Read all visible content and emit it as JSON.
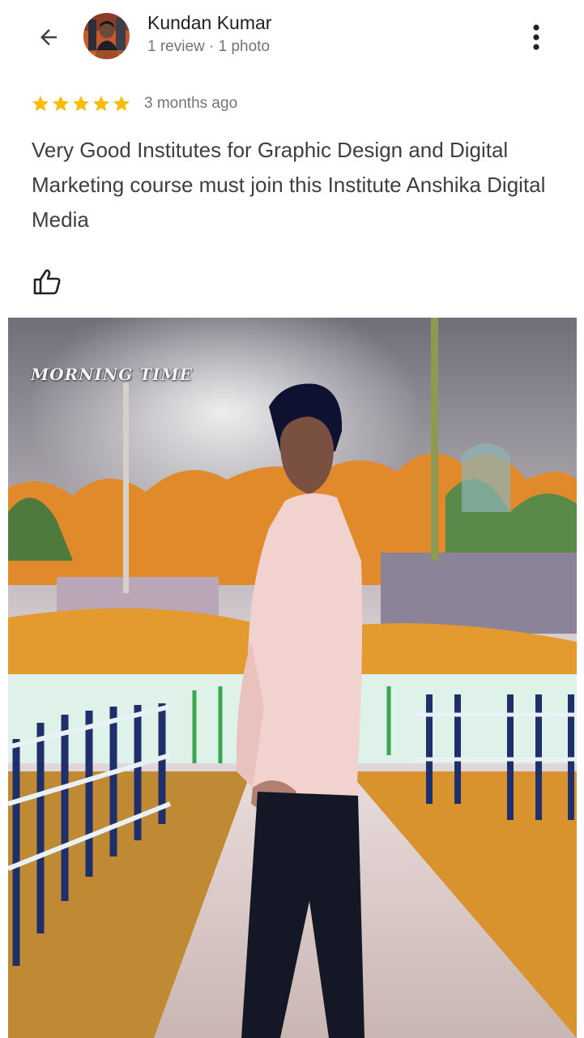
{
  "header": {
    "user_name": "Kundan Kumar",
    "user_meta": "1 review · 1 photo",
    "back_icon": "arrow-back-icon",
    "more_icon": "more-vert-icon"
  },
  "review": {
    "rating": 5,
    "rating_max": 5,
    "time": "3 months ago",
    "text": "Very Good Institutes for Graphic Design and Digital Marketing course must join this Institute Anshika Digital Media",
    "like_icon": "thumb-up-outline-icon"
  },
  "photo": {
    "caption": "MORNING TIME"
  },
  "colors": {
    "star": "#fbbc04",
    "text_primary": "#202124",
    "text_secondary": "#70757a",
    "review_text": "#3c4043"
  }
}
